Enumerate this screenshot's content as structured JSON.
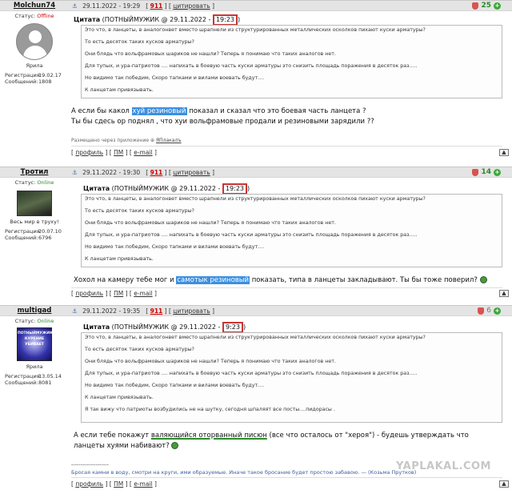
{
  "posts": [
    {
      "author": "Molchun74",
      "date": "29.11.2022 - 19:29",
      "num": "911",
      "cite": "цитировать",
      "rating": "25",
      "status_label": "Статус:",
      "status_value": "Offline",
      "sig": "Ярила",
      "reg_label": "Регистрация:",
      "reg_date": "19.02.17",
      "msgs_label": "Сообщений:",
      "msgs_count": "1808",
      "quote_title": "Цитата",
      "quote_src": "(ПОТНЫЙМУЖИК @ 29.11.2022 -",
      "quote_time": "19:23",
      "quote_close": ")",
      "quote_lines": [
        "Это что, в ланцеты, в аналогонвет вместо шрапнели из структурированных металлических осколков пихают куски арматуры?",
        "То есть десяток таких кусков арматуры?",
        "Они блядь что вольфрамовых шариков не нашли? Теперь я понимаю что таких аналогов нет.",
        "Для тупых, и ура-патриотов .... напихать в боевую часть куски арматуры это снизить площадь поражения в десяток раз.....",
        "Но видимо так победим, Скоро тапками и вилами воевать будут....",
        "К ланцетам привязывать."
      ],
      "msg_1_a": "А если бы какол ",
      "msg_1_hl": "хуй резиновый",
      "msg_1_b": " показал и сказал что это боевая часть ланцета ?",
      "msg_2": "Ты бы сдесь ор поднял , что хуи вольфрамовые продали и резиновыми зарядили ??",
      "via_text": "Размещено через приложение",
      "via_app": "ЯПлакалъ",
      "links": [
        "[ ",
        "профиль",
        " ] [ ",
        "ПМ",
        " ] [ ",
        "e-mail",
        " ]"
      ]
    },
    {
      "author": "Тротил",
      "date": "29.11.2022 - 19:30",
      "num": "911",
      "cite": "цитировать",
      "rating": "14",
      "status_label": "Статус:",
      "status_value": "Online",
      "sig": "Весь мир в труху!",
      "reg_label": "Регистрация:",
      "reg_date": "20.07.10",
      "msgs_label": "Сообщений:",
      "msgs_count": "6796",
      "quote_title": "Цитата",
      "quote_src": "(ПОТНЫЙМУЖИК @ 29.11.2022 -",
      "quote_time": "19:23",
      "quote_close": ")",
      "quote_lines": [
        "Это что, в ланцеты, в аналогонвет вместо шрапнели из структурированных металлических осколков пихают куски арматуры?",
        "То есть десяток таких кусков арматуры?",
        "Они блядь что вольфрамовых шариков не нашли? Теперь я понимаю что таких аналогов нет.",
        "Для тупых, и ура-патриотов .... напихать в боевую часть куски арматуры это снизить площадь поражения в десяток раз.....",
        "Но видимо так победим, Скоро тапками и вилами воевать будут....",
        "К ланцетам привязывать."
      ],
      "msg_1_a": "Хохол на камеру тебе мог и ",
      "msg_1_hl": "самотык резиновый",
      "msg_1_b": " показать, типа в ланцеты закладывают. Ты бы тоже поверил?",
      "links": [
        "[ ",
        "профиль",
        " ] [ ",
        "ПМ",
        " ] [ ",
        "e-mail",
        " ]"
      ]
    },
    {
      "author": "multigad",
      "date": "29.11.2022 - 19:35",
      "num": "911",
      "cite": "цитировать",
      "rating": "6",
      "status_label": "Статус:",
      "status_value": "Online",
      "avatar_text": "ПОТНЫЙМУЖИК КУРЕНИЕ УБИВАЕТ",
      "sig": "Ярила",
      "reg_label": "Регистрация:",
      "reg_date": "13.05.14",
      "msgs_label": "Сообщений:",
      "msgs_count": "8081",
      "quote_title": "Цитата",
      "quote_src": "(ПОТНЫЙМУЖИК @ 29.11.2022 -",
      "quote_time": "9:23",
      "quote_close": ")",
      "quote_lines": [
        "Это что, в ланцеты, в аналогонвет вместо шрапнели из структурированных металлических осколков пихают куски арматуры?",
        "То есть десяток таких кусков арматуры?",
        "Они блядь что вольфрамовых шариков не нашли? Теперь я понимаю что таких аналогов нет.",
        "Для тупых, и ура-патриотов .... напихать в боевую часть куски арматуры это снизить площадь поражения в десяток раз.....",
        "Но видимо так победим, Скоро тапками и вилами воевать будут....",
        "К ланцетам привязывать.",
        "Я так вижу что патриоты возбудились не на шутку, сегодня шпаляят все посты....пидорасы ."
      ],
      "msg_1_a": "А если тебе покажут ",
      "msg_1_ul": "валяющийся оторванный писюн",
      "msg_1_b": " (все что осталось от \"хероя\") - будешь утверждать что",
      "msg_2": "ланцеты хуями набивают?",
      "sig_rule": "--------------------",
      "sig_text": "Бросая камни в воду, смотри на круги, ими образуемые. Иначе такое бросание будет простою забавою. — (Козьма Прутков)",
      "links": [
        "[ ",
        "профиль",
        " ] [ ",
        "ПМ",
        " ] [ ",
        "e-mail",
        " ]"
      ]
    }
  ],
  "watermark": "YAPLAKAL.COM",
  "up_label": "▲"
}
